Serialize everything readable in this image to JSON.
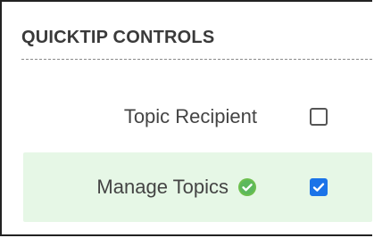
{
  "section": {
    "title": "QUICKTIP CONTROLS"
  },
  "rows": [
    {
      "label": "Topic Recipient",
      "checked": false
    },
    {
      "label": "Manage Topics",
      "checked": true,
      "status_icon": "check-circle-icon",
      "status_color": "#6cbf4e",
      "highlight_color": "#e6f7e6"
    }
  ],
  "colors": {
    "checkbox_checked": "#1a73e8",
    "text": "#444444"
  }
}
